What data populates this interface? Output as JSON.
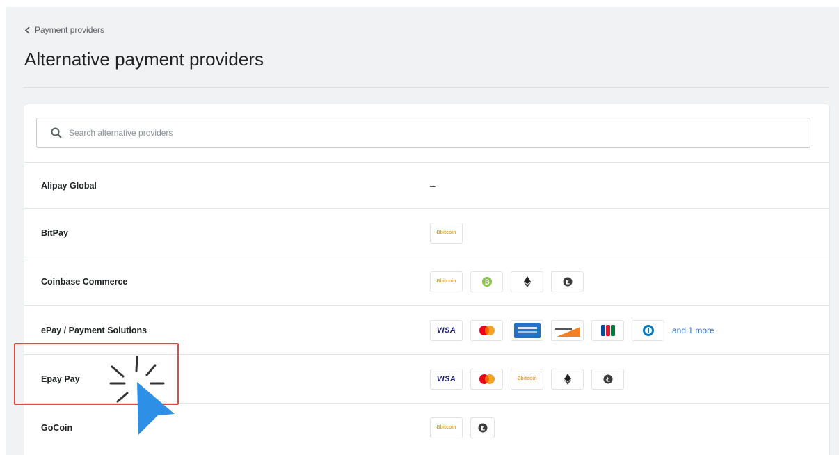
{
  "breadcrumb": {
    "label": "Payment providers"
  },
  "page": {
    "title": "Alternative payment providers"
  },
  "search": {
    "placeholder": "Search alternative providers"
  },
  "providers": [
    {
      "name": "Alipay Global",
      "methods": [],
      "empty_text": "–"
    },
    {
      "name": "BitPay",
      "methods": [
        "bitcoin-icon"
      ]
    },
    {
      "name": "Coinbase Commerce",
      "methods": [
        "bitcoin-icon",
        "bitcoin-cash-icon",
        "ethereum-icon",
        "litecoin-icon"
      ]
    },
    {
      "name": "ePay / Payment Solutions",
      "methods": [
        "visa-icon",
        "mastercard-icon",
        "amex-icon",
        "discover-icon",
        "jcb-icon",
        "diners-club-icon"
      ],
      "more_text": "and 1 more"
    },
    {
      "name": "Epay Pay",
      "methods": [
        "visa-icon",
        "mastercard-icon",
        "bitcoin-icon",
        "ethereum-icon",
        "litecoin-icon"
      ]
    },
    {
      "name": "GoCoin",
      "methods": [
        "bitcoin-icon",
        "litecoin-icon"
      ]
    }
  ],
  "icons": {
    "visa": "VISA",
    "bitcoin": "Ƀbitcoin"
  },
  "colors": {
    "highlight": "#e8463e",
    "cursor": "#2d8fe6",
    "link": "#2c6ecb"
  }
}
